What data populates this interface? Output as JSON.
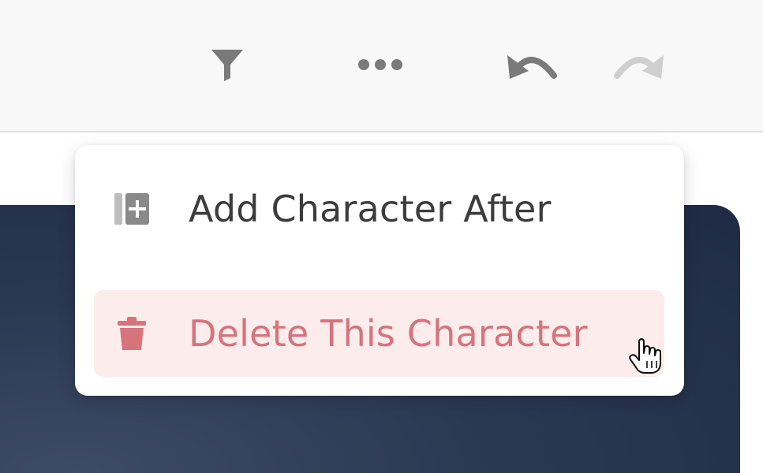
{
  "toolbar": {
    "filter_icon": "filter-icon",
    "more_icon": "more-horizontal-icon",
    "undo_icon": "undo-icon",
    "redo_icon": "redo-icon",
    "icon_color": "#7a7a7a",
    "disabled_icon_color": "#cfcfcf"
  },
  "menu": {
    "items": [
      {
        "label": "Add Character After",
        "icon": "add-column-icon",
        "color": "#3c3c3c"
      },
      {
        "label": "Delete This Character",
        "icon": "trash-icon",
        "color": "#d7737b",
        "highlight": "#fcecec"
      }
    ]
  },
  "colors": {
    "card_bg": "#243250",
    "danger": "#d7737b"
  }
}
